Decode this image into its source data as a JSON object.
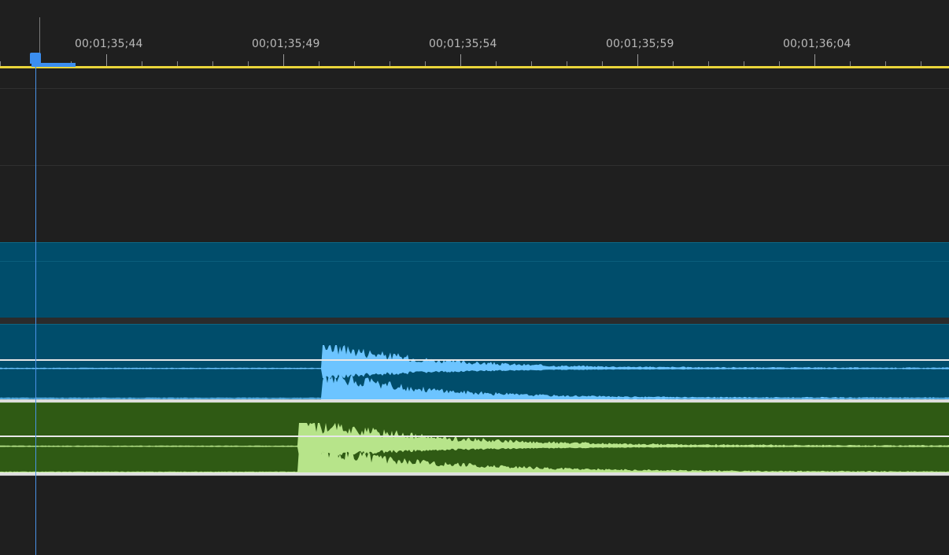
{
  "timeline": {
    "ruler": {
      "labels": [
        "00;01;35;44",
        "00;01;35;49",
        "00;01;35;54",
        "00;01;35;59",
        "00;01;36;04"
      ]
    },
    "colors": {
      "work_area": "#e9d43a",
      "playhead": "#3b8ef0",
      "video_clip": "#004d6b",
      "audio_clip_blue": "#004d6b",
      "audio_wave_blue": "#6cc4ff",
      "audio_clip_green": "#2f5a14",
      "audio_wave_green": "#b7e48a"
    },
    "tracks": [
      {
        "kind": "video",
        "state": "empty"
      },
      {
        "kind": "video",
        "state": "empty"
      },
      {
        "kind": "video",
        "state": "clip"
      },
      {
        "kind": "audio",
        "state": "clip",
        "waveform": "blue"
      },
      {
        "kind": "audio",
        "state": "clip",
        "waveform": "green"
      },
      {
        "kind": "audio",
        "state": "empty"
      }
    ]
  }
}
